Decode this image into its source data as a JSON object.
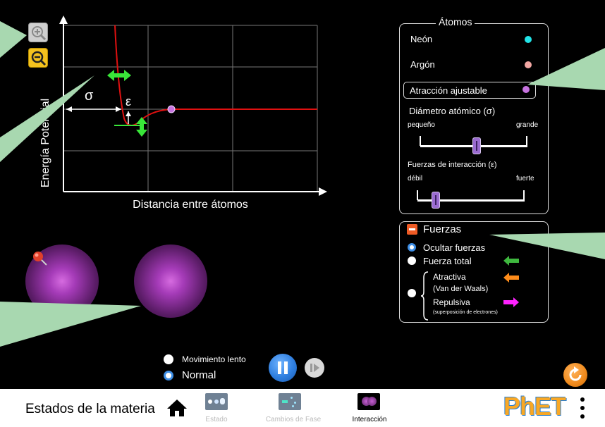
{
  "app": {
    "title": "Estados de la materia"
  },
  "graph": {
    "ylabel": "Energía Potencial",
    "xlabel": "Distancia entre átomos",
    "sigma_symbol": "σ",
    "epsilon_symbol": "ε"
  },
  "atoms_panel": {
    "title": "Átomos",
    "items": [
      {
        "label": "Neón",
        "color": "#22e4e8",
        "selected": false
      },
      {
        "label": "Argón",
        "color": "#f2a7a3",
        "selected": false
      },
      {
        "label": "Atracción ajustable",
        "color": "#c773e0",
        "selected": true
      }
    ],
    "diameter": {
      "label": "Diámetro atómico (σ)",
      "min_label": "pequeño",
      "max_label": "grande",
      "value": 0.55
    },
    "interaction": {
      "label": "Fuerzas de interacción (ε)",
      "min_label": "débil",
      "max_label": "fuerte",
      "value": 0.2
    }
  },
  "forces_panel": {
    "title": "Fuerzas",
    "options": [
      {
        "label": "Ocultar fuerzas",
        "selected": true
      },
      {
        "label": "Fuerza total",
        "selected": false,
        "arrow_color": "#3fb83f"
      }
    ],
    "components": {
      "attractive": "Atractiva",
      "attractive_sub": "(Van der Waals)",
      "attractive_color": "#ff8c1a",
      "repulsive": "Repulsiva",
      "repulsive_sub": "(superposición de electrones)",
      "repulsive_color": "#ff22ff"
    }
  },
  "speed": {
    "options": [
      {
        "label": "Movimiento lento",
        "selected": false
      },
      {
        "label": "Normal",
        "selected": true
      }
    ]
  },
  "nav": {
    "tabs": [
      {
        "label": "Estado",
        "active": false
      },
      {
        "label": "Cambios de Fase",
        "active": false
      },
      {
        "label": "Interacción",
        "active": true
      }
    ]
  },
  "colors": {
    "curve": "#e01010",
    "accent": "#3d8ee6",
    "reset": "#f08a1c"
  },
  "brand": "PhET"
}
